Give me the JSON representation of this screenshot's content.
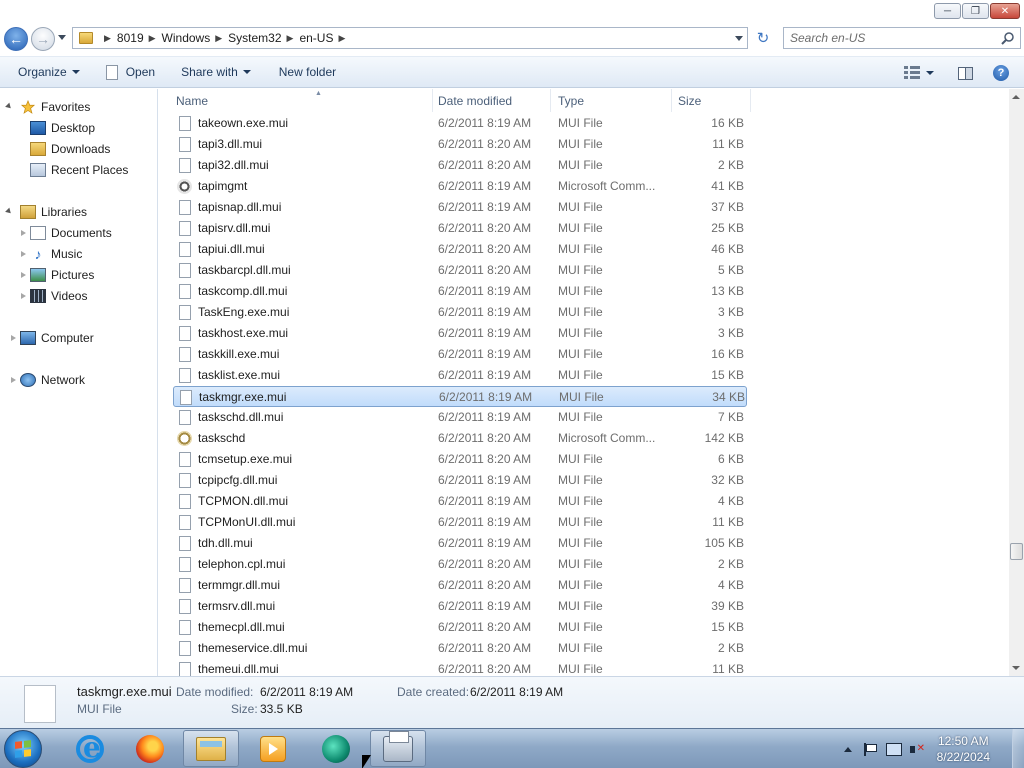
{
  "window": {
    "minimize": "─",
    "maximize": "❐",
    "close": "✕"
  },
  "address": {
    "crumbs": [
      "8019",
      "Windows",
      "System32",
      "en-US"
    ],
    "search_placeholder": "Search en-US"
  },
  "toolbar": {
    "organize": "Organize",
    "open": "Open",
    "share_with": "Share with",
    "new_folder": "New folder"
  },
  "nav": {
    "favorites": "Favorites",
    "desktop": "Desktop",
    "downloads": "Downloads",
    "recent_places": "Recent Places",
    "libraries": "Libraries",
    "documents": "Documents",
    "music": "Music",
    "pictures": "Pictures",
    "videos": "Videos",
    "computer": "Computer",
    "network": "Network"
  },
  "columns": {
    "name": "Name",
    "date_modified": "Date modified",
    "type": "Type",
    "size": "Size"
  },
  "files": [
    {
      "name": "takeown.exe.mui",
      "date": "6/2/2011 8:19 AM",
      "type": "MUI File",
      "size": "16 KB",
      "icon": "page-icon"
    },
    {
      "name": "tapi3.dll.mui",
      "date": "6/2/2011 8:20 AM",
      "type": "MUI File",
      "size": "11 KB",
      "icon": "page-icon"
    },
    {
      "name": "tapi32.dll.mui",
      "date": "6/2/2011 8:20 AM",
      "type": "MUI File",
      "size": "2 KB",
      "icon": "page-icon"
    },
    {
      "name": "tapimgmt",
      "date": "6/2/2011 8:19 AM",
      "type": "Microsoft Comm...",
      "size": "41 KB",
      "icon": "gear-icon"
    },
    {
      "name": "tapisnap.dll.mui",
      "date": "6/2/2011 8:19 AM",
      "type": "MUI File",
      "size": "37 KB",
      "icon": "page-icon"
    },
    {
      "name": "tapisrv.dll.mui",
      "date": "6/2/2011 8:20 AM",
      "type": "MUI File",
      "size": "25 KB",
      "icon": "page-icon"
    },
    {
      "name": "tapiui.dll.mui",
      "date": "6/2/2011 8:20 AM",
      "type": "MUI File",
      "size": "46 KB",
      "icon": "page-icon"
    },
    {
      "name": "taskbarcpl.dll.mui",
      "date": "6/2/2011 8:20 AM",
      "type": "MUI File",
      "size": "5 KB",
      "icon": "page-icon"
    },
    {
      "name": "taskcomp.dll.mui",
      "date": "6/2/2011 8:19 AM",
      "type": "MUI File",
      "size": "13 KB",
      "icon": "page-icon"
    },
    {
      "name": "TaskEng.exe.mui",
      "date": "6/2/2011 8:19 AM",
      "type": "MUI File",
      "size": "3 KB",
      "icon": "page-icon"
    },
    {
      "name": "taskhost.exe.mui",
      "date": "6/2/2011 8:19 AM",
      "type": "MUI File",
      "size": "3 KB",
      "icon": "page-icon"
    },
    {
      "name": "taskkill.exe.mui",
      "date": "6/2/2011 8:19 AM",
      "type": "MUI File",
      "size": "16 KB",
      "icon": "page-icon"
    },
    {
      "name": "tasklist.exe.mui",
      "date": "6/2/2011 8:19 AM",
      "type": "MUI File",
      "size": "15 KB",
      "icon": "page-icon"
    },
    {
      "name": "taskmgr.exe.mui",
      "date": "6/2/2011 8:19 AM",
      "type": "MUI File",
      "size": "34 KB",
      "icon": "page-icon",
      "selected": true
    },
    {
      "name": "taskschd.dll.mui",
      "date": "6/2/2011 8:19 AM",
      "type": "MUI File",
      "size": "7 KB",
      "icon": "page-icon"
    },
    {
      "name": "taskschd",
      "date": "6/2/2011 8:20 AM",
      "type": "Microsoft Comm...",
      "size": "142 KB",
      "icon": "clock-icon"
    },
    {
      "name": "tcmsetup.exe.mui",
      "date": "6/2/2011 8:20 AM",
      "type": "MUI File",
      "size": "6 KB",
      "icon": "page-icon"
    },
    {
      "name": "tcpipcfg.dll.mui",
      "date": "6/2/2011 8:19 AM",
      "type": "MUI File",
      "size": "32 KB",
      "icon": "page-icon"
    },
    {
      "name": "TCPMON.dll.mui",
      "date": "6/2/2011 8:19 AM",
      "type": "MUI File",
      "size": "4 KB",
      "icon": "page-icon"
    },
    {
      "name": "TCPMonUI.dll.mui",
      "date": "6/2/2011 8:19 AM",
      "type": "MUI File",
      "size": "11 KB",
      "icon": "page-icon"
    },
    {
      "name": "tdh.dll.mui",
      "date": "6/2/2011 8:19 AM",
      "type": "MUI File",
      "size": "105 KB",
      "icon": "page-icon"
    },
    {
      "name": "telephon.cpl.mui",
      "date": "6/2/2011 8:20 AM",
      "type": "MUI File",
      "size": "2 KB",
      "icon": "page-icon"
    },
    {
      "name": "termmgr.dll.mui",
      "date": "6/2/2011 8:20 AM",
      "type": "MUI File",
      "size": "4 KB",
      "icon": "page-icon"
    },
    {
      "name": "termsrv.dll.mui",
      "date": "6/2/2011 8:19 AM",
      "type": "MUI File",
      "size": "39 KB",
      "icon": "page-icon"
    },
    {
      "name": "themecpl.dll.mui",
      "date": "6/2/2011 8:20 AM",
      "type": "MUI File",
      "size": "15 KB",
      "icon": "page-icon"
    },
    {
      "name": "themeservice.dll.mui",
      "date": "6/2/2011 8:20 AM",
      "type": "MUI File",
      "size": "2 KB",
      "icon": "page-icon"
    },
    {
      "name": "themeui.dll.mui",
      "date": "6/2/2011 8:20 AM",
      "type": "MUI File",
      "size": "11 KB",
      "icon": "page-icon"
    }
  ],
  "details": {
    "name": "taskmgr.exe.mui",
    "type": "MUI File",
    "date_modified_label": "Date modified:",
    "date_modified": "6/2/2011 8:19 AM",
    "date_created_label": "Date created:",
    "date_created": "6/2/2011 8:19 AM",
    "size_label": "Size:",
    "size": "33.5 KB"
  },
  "taskbar": {
    "time": "12:50 AM",
    "date": "8/22/2024"
  }
}
